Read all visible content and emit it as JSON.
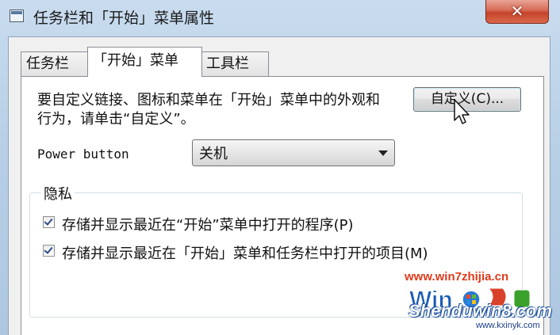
{
  "window": {
    "title": "任务栏和「开始」菜单属性",
    "close_label": "✕"
  },
  "tabs": [
    {
      "label": "任务栏",
      "active": false
    },
    {
      "label": "「开始」菜单",
      "active": true
    },
    {
      "label": "工具栏",
      "active": false
    }
  ],
  "start_menu": {
    "description": "要自定义链接、图标和菜单在「开始」菜单中的外观和行为，请单击“自定义”。",
    "customize_button": "自定义(C)...",
    "power_button_label": "Power button",
    "power_button_value": "关机"
  },
  "privacy": {
    "legend": "隐私",
    "options": [
      {
        "label": "存储并显示最近在“开始”菜单中打开的程序(P)",
        "checked": true
      },
      {
        "label": "存储并显示最近在「开始」菜单和任务栏中打开的项目(M)",
        "checked": true
      }
    ]
  },
  "watermark": {
    "url": "www.win7zhijia.cn",
    "brand": "Shenduwin8.com",
    "site": "www.kxinyk.com"
  },
  "icons": {
    "window": "window-icon",
    "dropdown": "chevron-down-icon",
    "cursor": "mouse-pointer-icon",
    "check": "checkmark-icon"
  }
}
